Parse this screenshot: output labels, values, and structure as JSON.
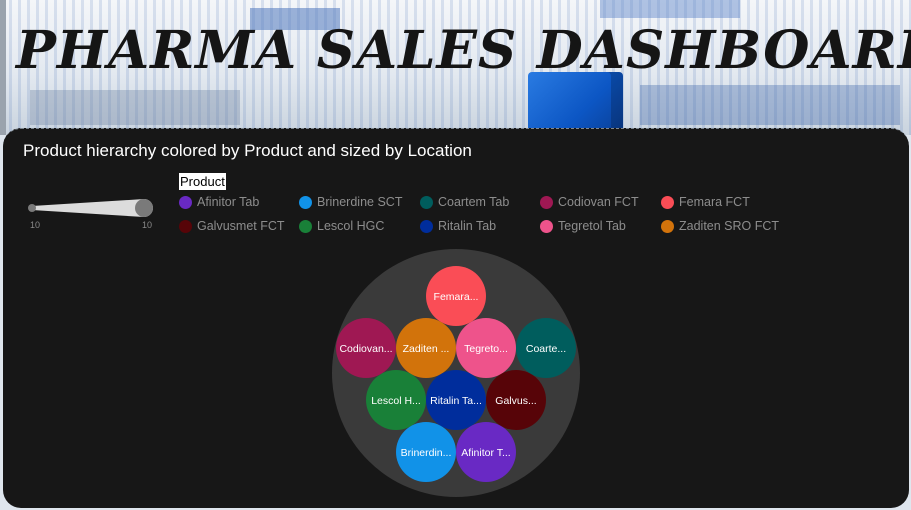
{
  "banner": {
    "title": "PHARMA SALES DASHBOARD"
  },
  "panel": {
    "title": "Product hierarchy colored by Product and sized by Location"
  },
  "size_legend": {
    "min_label": "10",
    "max_label": "10"
  },
  "legend": {
    "title": "Product",
    "items": [
      {
        "label": "Afinitor Tab",
        "color": "#6929c4"
      },
      {
        "label": "Brinerdine SCT",
        "color": "#1192e8"
      },
      {
        "label": "Coartem Tab",
        "color": "#005d5d"
      },
      {
        "label": "Codiovan FCT",
        "color": "#9f1853"
      },
      {
        "label": "Femara FCT",
        "color": "#fa4d56"
      },
      {
        "label": "Galvusmet FCT",
        "color": "#570408"
      },
      {
        "label": "Lescol HGC",
        "color": "#198038"
      },
      {
        "label": "Ritalin Tab",
        "color": "#002d9c"
      },
      {
        "label": "Tegretol Tab",
        "color": "#ee538b"
      },
      {
        "label": "Zaditen SRO FCT",
        "color": "#d2730b"
      }
    ]
  },
  "chart_data": {
    "type": "bubble",
    "title": "Product hierarchy colored by Product and sized by Location",
    "group_color": "#3a3a3a",
    "bubbles": [
      {
        "label": "Femara...",
        "product": "Femara FCT",
        "color": "#fa4d56"
      },
      {
        "label": "Codiovan...",
        "product": "Codiovan FCT",
        "color": "#9f1853"
      },
      {
        "label": "Zaditen ...",
        "product": "Zaditen SRO FCT",
        "color": "#d2730b"
      },
      {
        "label": "Tegreto...",
        "product": "Tegretol Tab",
        "color": "#ee538b"
      },
      {
        "label": "Coarte...",
        "product": "Coartem Tab",
        "color": "#005d5d"
      },
      {
        "label": "Lescol H...",
        "product": "Lescol HGC",
        "color": "#198038"
      },
      {
        "label": "Ritalin Ta...",
        "product": "Ritalin Tab",
        "color": "#002d9c"
      },
      {
        "label": "Galvus...",
        "product": "Galvusmet FCT",
        "color": "#570408"
      },
      {
        "label": "Brinerdin...",
        "product": "Brinerdine SCT",
        "color": "#1192e8"
      },
      {
        "label": "Afinitor T...",
        "product": "Afinitor Tab",
        "color": "#6929c4"
      }
    ]
  }
}
